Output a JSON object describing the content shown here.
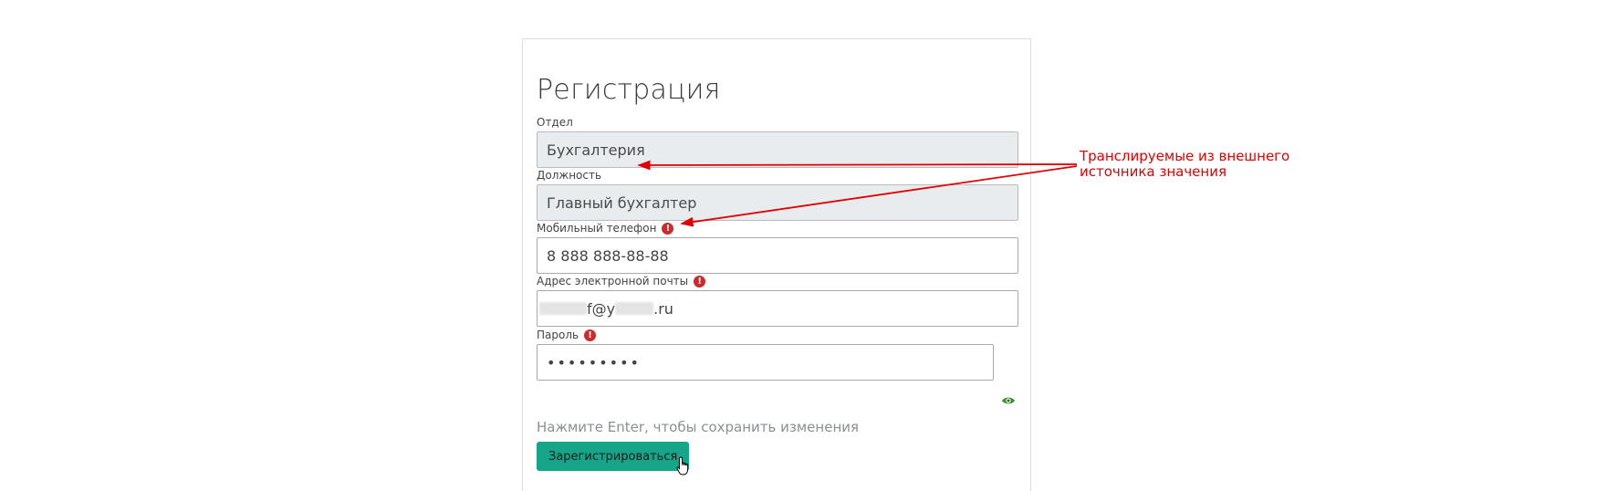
{
  "form": {
    "title": "Регистрация",
    "department": {
      "label": "Отдел",
      "value": "Бухгалтерия"
    },
    "position": {
      "label": "Должность",
      "value": "Главный бухгалтер"
    },
    "phone": {
      "label": "Мобильный телефон",
      "value": "8 888 888-88-88"
    },
    "email": {
      "label": "Адрес электронной почты",
      "value_visible_1": "f@y",
      "value_visible_2": ".ru"
    },
    "password": {
      "label": "Пароль",
      "value": "•••••••••"
    },
    "hint": "Нажмите Enter, чтобы сохранить изменения",
    "submit_label": "Зарегистрироваться"
  },
  "annotation": {
    "line1": "Транслируемые из внешнего",
    "line2": "источника значения",
    "color": "#e00000"
  },
  "icons": {
    "required": "exclamation-circle",
    "show_password": "eye",
    "cursor": "hand-pointer"
  },
  "colors": {
    "accent": "#17a589",
    "required": "#cc2b2b",
    "readonly_bg": "#e9ecef"
  }
}
